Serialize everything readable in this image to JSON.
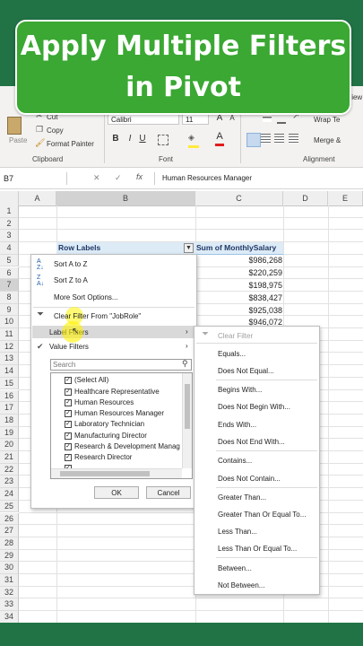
{
  "banner": {
    "line1": "Apply Multiple Filters",
    "line2": "in Pivot"
  },
  "ribbon": {
    "paste": "Paste",
    "cut": "Cut",
    "copy": "Copy",
    "format_painter": "Format Painter",
    "clipboard": "Clipboard",
    "font_name": "Calibri",
    "font_size": "11",
    "font": "Font",
    "alignment": "Alignment",
    "wrap_text": "Wrap Te",
    "merge": "Merge &",
    "partial_view": "View",
    "bold": "B",
    "italic": "I",
    "underline": "U",
    "grow": "A",
    "shrink": "A"
  },
  "formula_bar": {
    "name_box": "B7",
    "cancel": "✕",
    "enter": "✓",
    "fx": "fx",
    "value": "Human Resources Manager"
  },
  "columns": [
    "A",
    "B",
    "C",
    "D",
    "E"
  ],
  "rows": [
    "1",
    "2",
    "3",
    "4",
    "5",
    "6",
    "7",
    "8",
    "9",
    "10",
    "11",
    "12",
    "13",
    "14",
    "15",
    "16",
    "17",
    "18",
    "19",
    "20",
    "21",
    "22",
    "23",
    "24",
    "25",
    "26",
    "27",
    "28",
    "29",
    "30",
    "31",
    "32",
    "33",
    "34"
  ],
  "pivot": {
    "row_labels": "Row Labels",
    "sum_header": "Sum of MonthlySalary",
    "values": [
      "$986,268",
      "$220,259",
      "$198,975",
      "$838,427",
      "$925,038",
      "$946,072"
    ]
  },
  "filter_menu": {
    "sort_az": "Sort A to Z",
    "sort_za": "Sort Z to A",
    "more_sort": "More Sort Options...",
    "clear_filter": "Clear Filter From \"JobRole\"",
    "label_filters": "Label Filters",
    "value_filters": "Value Filters",
    "search_placeholder": "Search",
    "items": [
      "(Select All)",
      "Healthcare Representative",
      "Human Resources",
      "Human Resources Manager",
      "Laboratory Technician",
      "Manufacturing Director",
      "Research & Development Manag",
      "Research Director"
    ],
    "ok": "OK",
    "cancel": "Cancel"
  },
  "label_submenu": {
    "clear_filter": "Clear Filter",
    "items": [
      "Equals...",
      "Does Not Equal...",
      "Begins With...",
      "Does Not Begin With...",
      "Ends With...",
      "Does Not End With...",
      "Contains...",
      "Does Not Contain...",
      "Greater Than...",
      "Greater Than Or Equal To...",
      "Less Than...",
      "Less Than Or Equal To...",
      "Between...",
      "Not Between..."
    ]
  },
  "colors": {
    "excel_green": "#217346",
    "banner_green": "#3aa832",
    "pivot_header": "#ddebf7",
    "highlight": "#fff200"
  }
}
